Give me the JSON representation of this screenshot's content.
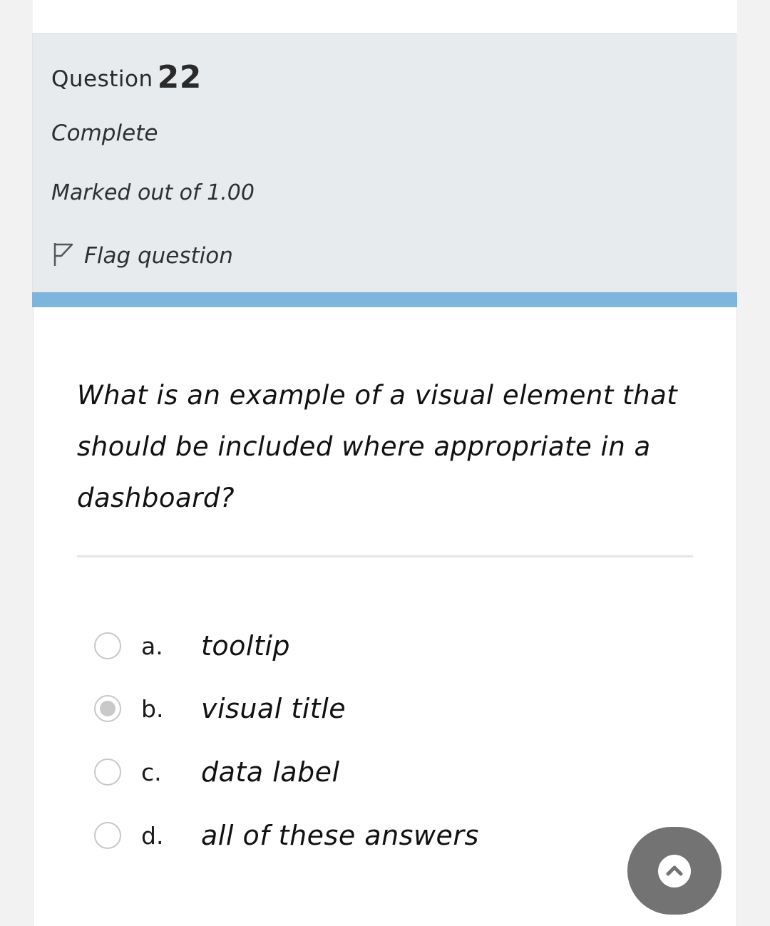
{
  "question": {
    "label": "Question",
    "number": "22",
    "state": "Complete",
    "grade": "Marked out of 1.00",
    "flag_label": "Flag question",
    "text": "What is an example of a visual element that should be included where appropriate in a dashboard?"
  },
  "options": [
    {
      "letter": "a.",
      "text": "tooltip",
      "selected": false
    },
    {
      "letter": "b.",
      "text": "visual title",
      "selected": true
    },
    {
      "letter": "c.",
      "text": "data label",
      "selected": false
    },
    {
      "letter": "d.",
      "text": "all of these answers",
      "selected": false
    }
  ],
  "icons": {
    "flag": "flag-icon",
    "scroll_top": "chevron-up-icon"
  },
  "colors": {
    "info_panel_bg": "#e7ebee",
    "accent_bar": "#7eb5dc",
    "scroll_button": "#737373"
  }
}
